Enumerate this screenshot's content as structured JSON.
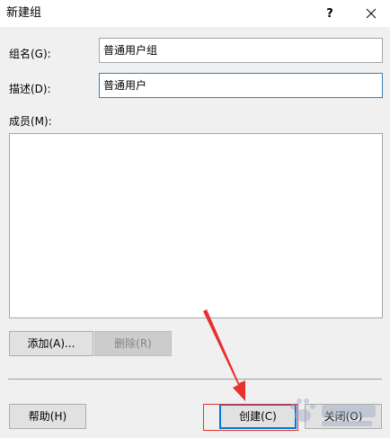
{
  "window": {
    "title": "新建组",
    "help_glyph": "?",
    "close_glyph": "✕"
  },
  "form": {
    "group_name_label": "组名(G):",
    "group_name_value": "普通用户组",
    "description_label": "描述(D):",
    "description_value": "普通用户",
    "members_label": "成员(M):"
  },
  "buttons": {
    "add_label": "添加(A)...",
    "remove_label": "删除(R)",
    "help_label": "帮助(H)",
    "create_label": "创建(C)",
    "close_label": "关闭(O)"
  },
  "colors": {
    "annotation": "#e8302e",
    "focus_border": "#3c7fb1",
    "default_button_border": "#0078d7"
  },
  "icons": {
    "annotation_arrow": "red-arrow-icon",
    "watermark": "baidu-paw-watermark-icon"
  }
}
